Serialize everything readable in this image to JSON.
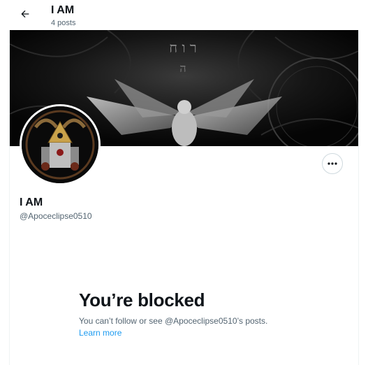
{
  "header": {
    "title": "I AM",
    "post_count": "4 posts"
  },
  "banner": {
    "description": "dark occult artwork with winged figure",
    "glyphs": "ר ו ח"
  },
  "profile": {
    "display_name": "I AM",
    "handle": "@Apoceclipse0510"
  },
  "blocked": {
    "title": "You’re blocked",
    "description": "You can’t follow or see @Apoceclipse0510’s posts.",
    "learn_more": "Learn more"
  },
  "icons": {
    "back": "arrow-left-icon",
    "more": "more-horizontal-icon"
  },
  "colors": {
    "text_primary": "#0f1419",
    "text_secondary": "#536471",
    "link": "#1d9bf0",
    "border": "#cfd9de"
  }
}
